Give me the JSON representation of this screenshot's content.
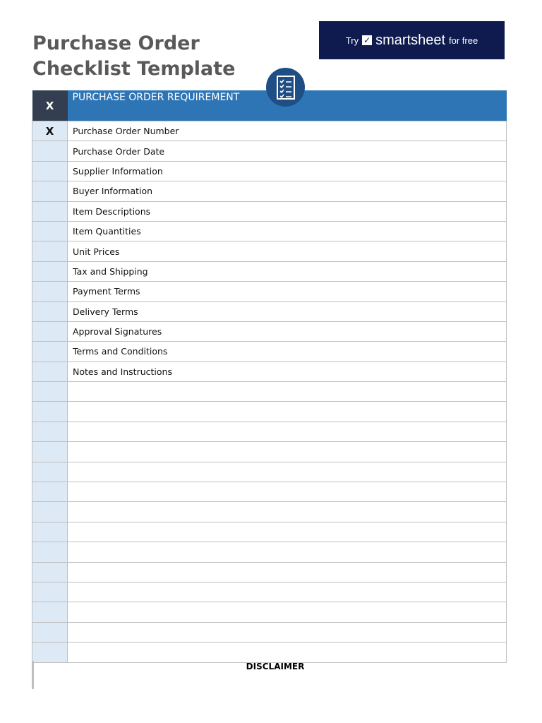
{
  "title_line1": "Purchase Order",
  "title_line2": "Checklist Template",
  "banner": {
    "try": "Try",
    "brand": "smartsheet",
    "free": "for free"
  },
  "table": {
    "header_check": "X",
    "header_label": "PURCHASE ORDER REQUIREMENT",
    "rows": [
      {
        "check": "X",
        "label": "Purchase Order Number"
      },
      {
        "check": "",
        "label": "Purchase Order Date"
      },
      {
        "check": "",
        "label": "Supplier Information"
      },
      {
        "check": "",
        "label": "Buyer Information"
      },
      {
        "check": "",
        "label": "Item Descriptions"
      },
      {
        "check": "",
        "label": "Item Quantities"
      },
      {
        "check": "",
        "label": "Unit Prices"
      },
      {
        "check": "",
        "label": "Tax and Shipping"
      },
      {
        "check": "",
        "label": "Payment Terms"
      },
      {
        "check": "",
        "label": "Delivery Terms"
      },
      {
        "check": "",
        "label": "Approval Signatures"
      },
      {
        "check": "",
        "label": "Terms and Conditions"
      },
      {
        "check": "",
        "label": "Notes and Instructions"
      },
      {
        "check": "",
        "label": ""
      },
      {
        "check": "",
        "label": ""
      },
      {
        "check": "",
        "label": ""
      },
      {
        "check": "",
        "label": ""
      },
      {
        "check": "",
        "label": ""
      },
      {
        "check": "",
        "label": ""
      },
      {
        "check": "",
        "label": ""
      },
      {
        "check": "",
        "label": ""
      },
      {
        "check": "",
        "label": ""
      },
      {
        "check": "",
        "label": ""
      },
      {
        "check": "",
        "label": ""
      },
      {
        "check": "",
        "label": ""
      },
      {
        "check": "",
        "label": ""
      },
      {
        "check": "",
        "label": ""
      }
    ]
  },
  "disclaimer": "DISCLAIMER"
}
